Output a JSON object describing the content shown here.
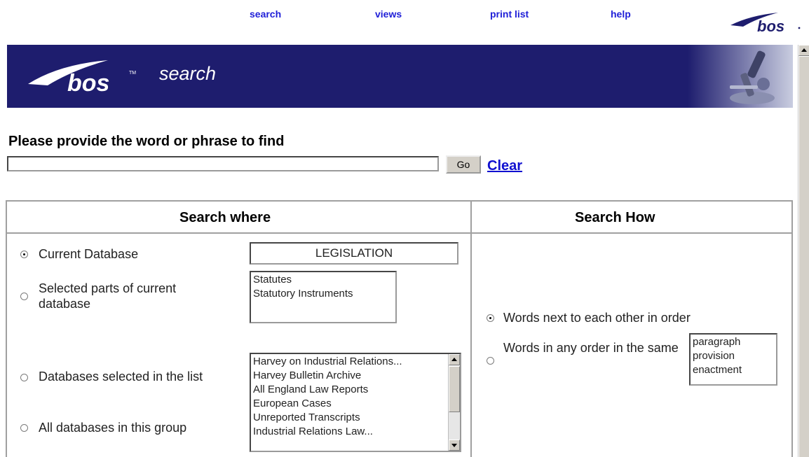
{
  "nav": {
    "search": "search",
    "views": "views",
    "print_list": "print list",
    "help": "help"
  },
  "logo_text": "bos",
  "banner": {
    "logo_text": "bos",
    "title": "search"
  },
  "search": {
    "prompt": "Please provide the word or phrase to find",
    "value": "",
    "go_label": "Go",
    "clear_label": "Clear"
  },
  "where": {
    "heading": "Search where",
    "current_db_label": "Current Database",
    "current_db_value": "LEGISLATION",
    "selected_parts_label": "Selected parts of current database",
    "parts": [
      "Statutes",
      "Statutory Instruments"
    ],
    "databases_selected_label": "Databases selected in the list",
    "all_databases_label": "All databases in this group",
    "databases": [
      "Harvey on Industrial Relations...",
      "Harvey Bulletin Archive",
      "All England Law Reports",
      "European Cases",
      "Unreported Transcripts",
      "Industrial Relations Law..."
    ]
  },
  "how": {
    "heading": "Search How",
    "next_to_each_label": "Words next to each other in order",
    "any_order_label": "Words in any order in the same",
    "units": [
      "paragraph",
      "provision",
      "enactment"
    ]
  },
  "colors": {
    "banner": "#1e1d6e",
    "nav_link": "#2020d8",
    "clear_link": "#1010d0"
  }
}
